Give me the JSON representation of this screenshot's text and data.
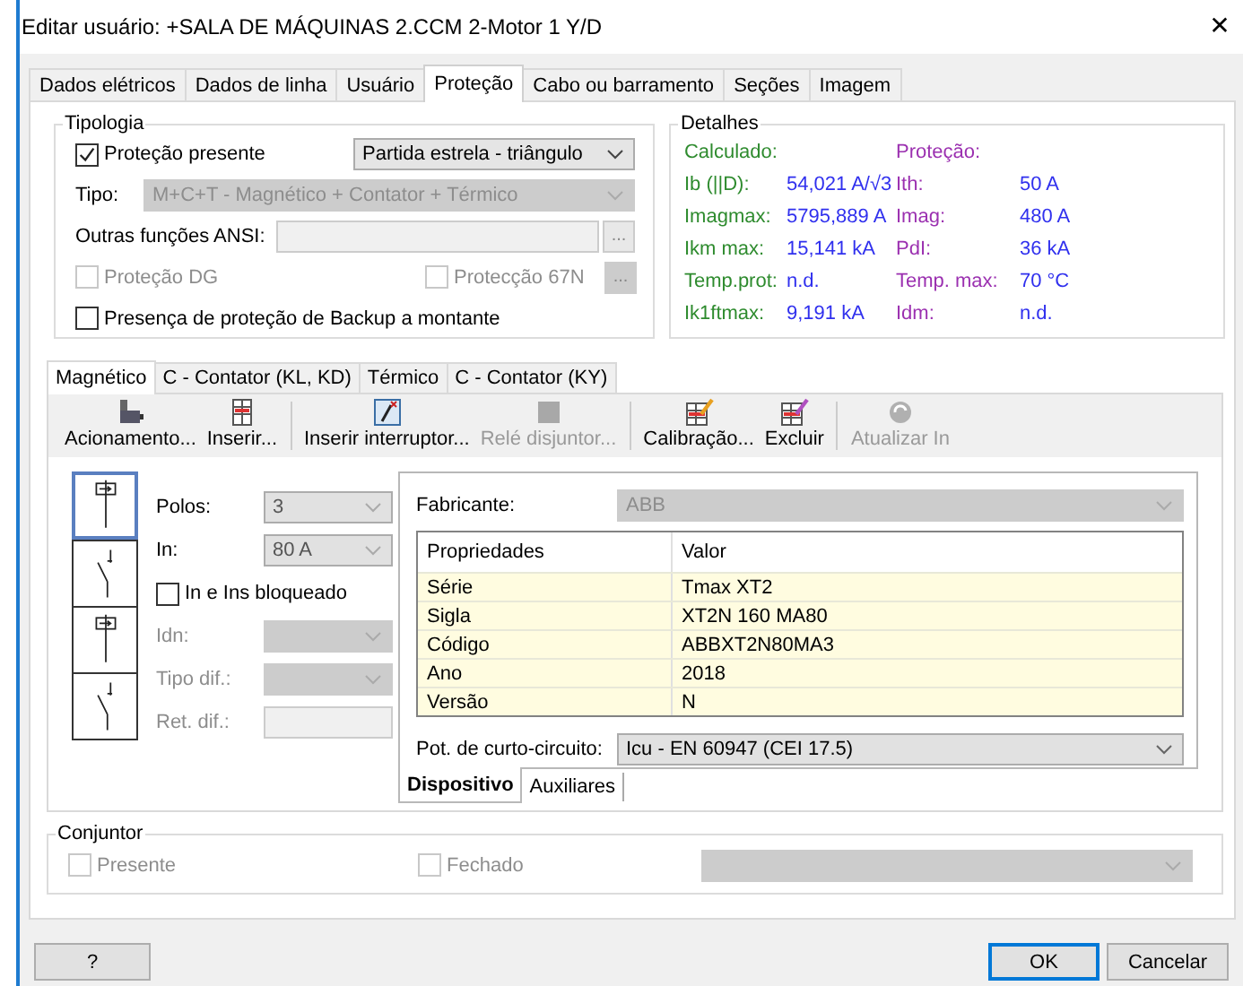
{
  "window": {
    "title": "Editar usuário: +SALA DE MÁQUINAS 2.CCM 2-Motor 1 Y/D",
    "close": "✕"
  },
  "tabs": [
    {
      "label": "Dados elétricos",
      "selected": false
    },
    {
      "label": "Dados de linha",
      "selected": false
    },
    {
      "label": "Usuário",
      "selected": false
    },
    {
      "label": "Proteção",
      "selected": true
    },
    {
      "label": "Cabo ou barramento",
      "selected": false
    },
    {
      "label": "Seções",
      "selected": false
    },
    {
      "label": "Imagem",
      "selected": false
    }
  ],
  "tipologia": {
    "title": "Tipologia",
    "present": {
      "label": "Proteção presente",
      "checked": true
    },
    "start_type": {
      "value": "Partida estrela - triângulo"
    },
    "tipo": {
      "label": "Tipo:",
      "value": "M+C+T - Magnético + Contator + Térmico",
      "disabled": true
    },
    "ansi": {
      "label": "Outras funções ANSI:",
      "button": "..."
    },
    "dg": {
      "label": "Proteção DG",
      "checked": false,
      "disabled": true
    },
    "p67n": {
      "label": "Protecção 67N",
      "checked": false,
      "disabled": true,
      "button": "..."
    },
    "backup": {
      "label": "Presença de proteção de Backup a montante",
      "checked": false
    }
  },
  "details": {
    "title": "Detalhes",
    "calc_header": "Calculado:",
    "prot_header": "Proteção:",
    "rows": [
      {
        "calc_label": "Ib (||D):",
        "calc_value": "54,021 A/√3",
        "prot_label": "Ith:",
        "prot_value": "50 A"
      },
      {
        "calc_label": "Imagmax:",
        "calc_value": "5795,889 A",
        "prot_label": "Imag:",
        "prot_value": "480 A"
      },
      {
        "calc_label": "Ikm max:",
        "calc_value": "15,141 kA",
        "prot_label": "PdI:",
        "prot_value": "36 kA"
      },
      {
        "calc_label": "Temp.prot:",
        "calc_value": "n.d.",
        "prot_label": "Temp. max:",
        "prot_value": "70 °C"
      },
      {
        "calc_label": "Ik1ftmax:",
        "calc_value": "9,191 kA",
        "prot_label": "Idm:",
        "prot_value": "n.d."
      }
    ]
  },
  "inner_tabs": [
    {
      "label": "Magnético",
      "selected": true
    },
    {
      "label": "C - Contator (KL, KD)",
      "selected": false
    },
    {
      "label": "Térmico",
      "selected": false
    },
    {
      "label": "C - Contator (KY)",
      "selected": false
    }
  ],
  "toolbar": [
    {
      "kind": "motor",
      "label": "Acionamento...",
      "disabled": false
    },
    {
      "kind": "grid",
      "label": "Inserir...",
      "disabled": false
    },
    {
      "kind": "separator"
    },
    {
      "kind": "switch",
      "label": "Inserir interruptor...",
      "disabled": false
    },
    {
      "kind": "relay",
      "label": "Relé disjuntor...",
      "disabled": true
    },
    {
      "kind": "separator"
    },
    {
      "kind": "calibrate",
      "label": "Calibração...",
      "disabled": false
    },
    {
      "kind": "delete",
      "label": "Excluir",
      "disabled": false
    },
    {
      "kind": "separator"
    },
    {
      "kind": "refresh",
      "label": "Atualizar In",
      "disabled": true
    }
  ],
  "symbols": [
    {
      "kind": "relay",
      "selected": true
    },
    {
      "kind": "switch",
      "selected": false
    },
    {
      "kind": "relay",
      "selected": false
    },
    {
      "kind": "switch",
      "selected": false
    }
  ],
  "fields": [
    {
      "kind": "select",
      "label": "Polos:",
      "value": "3",
      "disabled": false
    },
    {
      "kind": "select",
      "label": "In:",
      "value": "80 A",
      "disabled": false
    },
    {
      "kind": "check",
      "label": "In e Ins bloqueado",
      "checked": false
    },
    {
      "kind": "select",
      "label": "Idn:",
      "disabled": true
    },
    {
      "kind": "select",
      "label": "Tipo dif.:",
      "disabled": true
    },
    {
      "kind": "input",
      "label": "Ret. dif.:",
      "disabled": true
    }
  ],
  "device": {
    "fabricante": {
      "label": "Fabricante:",
      "value": "ABB"
    },
    "columns": [
      "Propriedades",
      "Valor"
    ],
    "rows": [
      [
        "Série",
        "Tmax XT2"
      ],
      [
        "Sigla",
        "XT2N 160 MA80"
      ],
      [
        "Código",
        "ABBXT2N80MA3"
      ],
      [
        "Ano",
        "2018"
      ],
      [
        "Versão",
        "N"
      ]
    ],
    "pot": {
      "label": "Pot. de curto-circuito:",
      "value": "Icu - EN 60947 (CEI 17.5)"
    },
    "sub_tabs": [
      {
        "label": "Dispositivo",
        "selected": true
      },
      {
        "label": "Auxiliares",
        "selected": false
      }
    ]
  },
  "conjuntor": {
    "title": "Conjuntor",
    "presente": {
      "label": "Presente",
      "checked": false,
      "disabled": true
    },
    "fechado": {
      "label": "Fechado",
      "checked": false,
      "disabled": true
    }
  },
  "buttons": {
    "help": "?",
    "ok": "OK",
    "cancel": "Cancelar"
  }
}
